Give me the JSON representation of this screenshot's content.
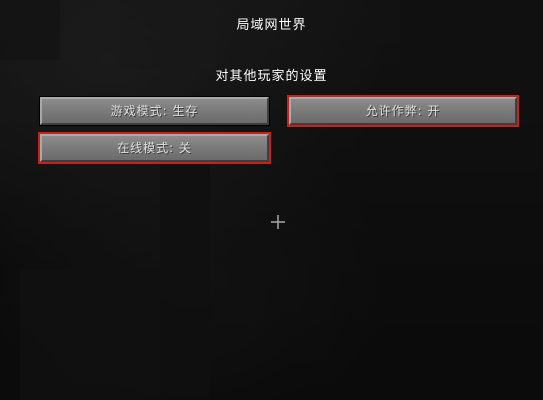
{
  "screen": {
    "title": "局域网世界",
    "subtitle": "对其他玩家的设置"
  },
  "buttons": {
    "game_mode": "游戏模式: 生存",
    "allow_cheats": "允许作弊: 开",
    "online_mode": "在线模式: 关"
  },
  "colors": {
    "highlight": "#c8201a",
    "button_face": "#7a7a7a",
    "text": "#ffffff"
  },
  "icons": {
    "crosshair": "crosshair-icon"
  }
}
